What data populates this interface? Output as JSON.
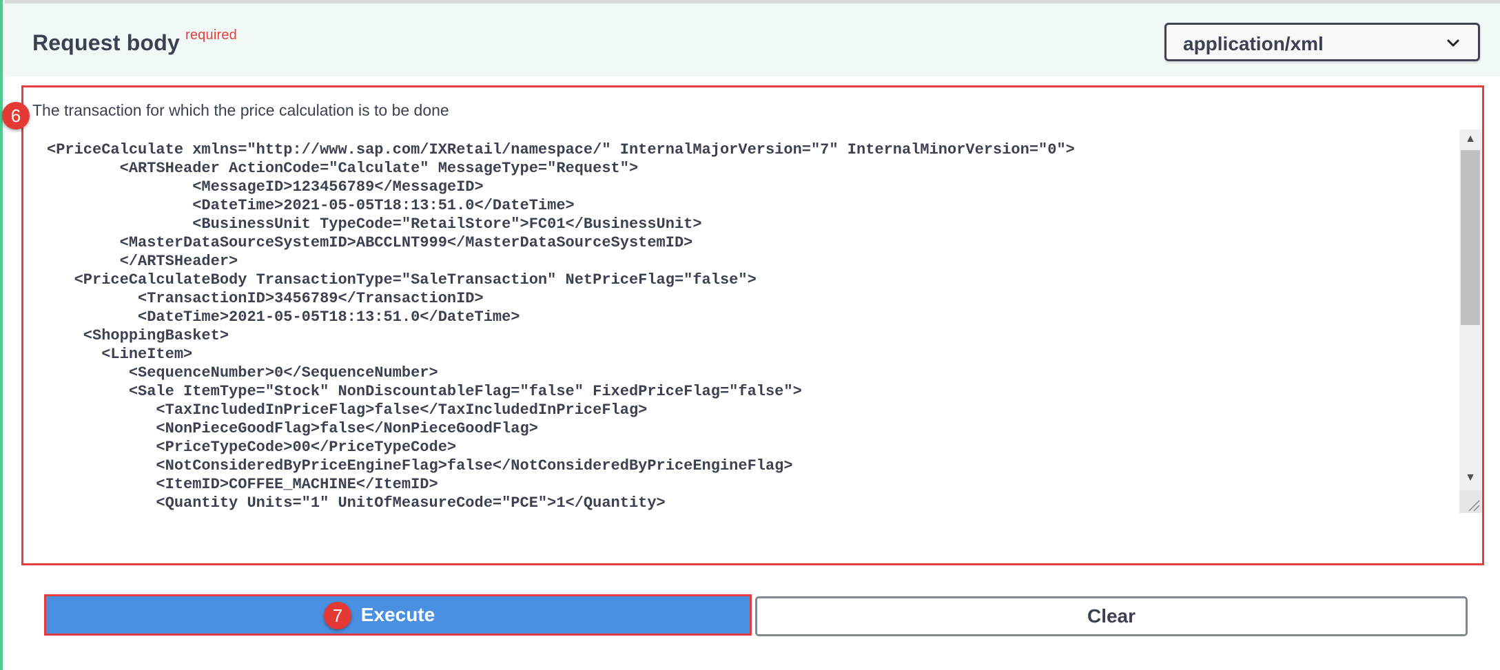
{
  "request_body": {
    "title": "Request body",
    "required_label": "required",
    "content_type": {
      "selected": "application/xml",
      "icon": "chevron-down-icon"
    },
    "description": "The transaction for which the price calculation is to be done",
    "code_lines": [
      "<PriceCalculate xmlns=\"http://www.sap.com/IXRetail/namespace/\" InternalMajorVersion=\"7\" InternalMinorVersion=\"0\">",
      "        <ARTSHeader ActionCode=\"Calculate\" MessageType=\"Request\">",
      "                <MessageID>123456789</MessageID>",
      "                <DateTime>2021-05-05T18:13:51.0</DateTime>",
      "                <BusinessUnit TypeCode=\"RetailStore\">FC01</BusinessUnit>",
      "        <MasterDataSourceSystemID>ABCCLNT999</MasterDataSourceSystemID>",
      "        </ARTSHeader>",
      "   <PriceCalculateBody TransactionType=\"SaleTransaction\" NetPriceFlag=\"false\">",
      "          <TransactionID>3456789</TransactionID>",
      "          <DateTime>2021-05-05T18:13:51.0</DateTime>",
      "    <ShoppingBasket>",
      "      <LineItem>",
      "         <SequenceNumber>0</SequenceNumber>",
      "         <Sale ItemType=\"Stock\" NonDiscountableFlag=\"false\" FixedPriceFlag=\"false\">",
      "            <TaxIncludedInPriceFlag>false</TaxIncludedInPriceFlag>",
      "            <NonPieceGoodFlag>false</NonPieceGoodFlag>",
      "            <PriceTypeCode>00</PriceTypeCode>",
      "            <NotConsideredByPriceEngineFlag>false</NotConsideredByPriceEngineFlag>",
      "            <ItemID>COFFEE_MACHINE</ItemID>",
      "            <Quantity Units=\"1\" UnitOfMeasureCode=\"PCE\">1</Quantity>"
    ]
  },
  "annotations": {
    "marker_body": "6",
    "marker_execute": "7"
  },
  "actions": {
    "execute_label": "Execute",
    "clear_label": "Clear"
  },
  "colors": {
    "execute_bg": "#4990e2",
    "highlight_border": "#e53e3e",
    "marker_bg": "#e53935",
    "header_band": "#f1f9f6",
    "text": "#3b4151"
  }
}
